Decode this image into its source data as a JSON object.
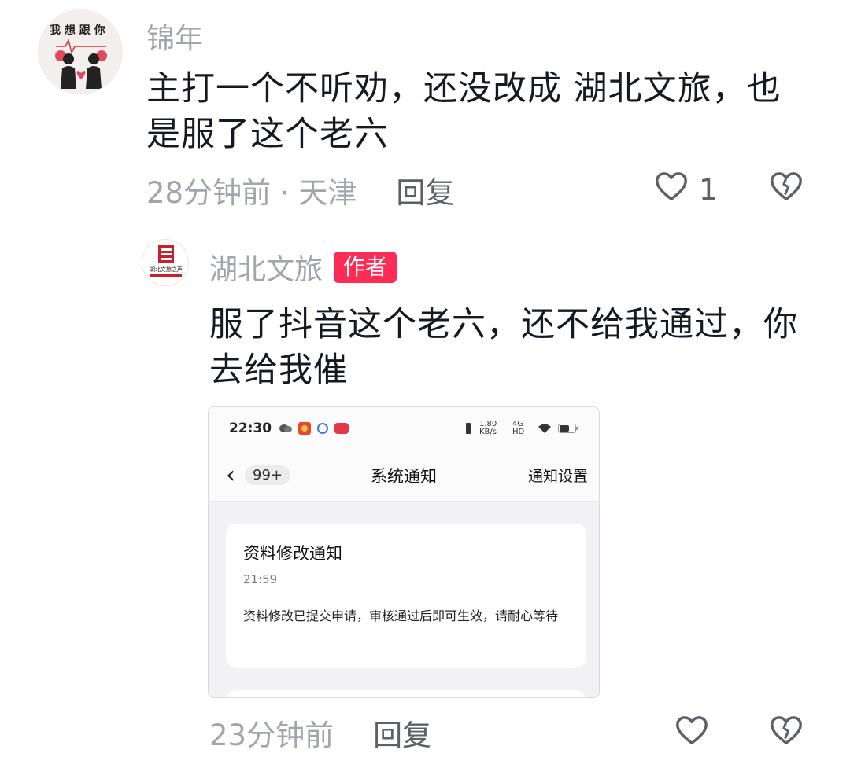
{
  "comment": {
    "username": "锦年",
    "text": "主打一个不听劝，还没改成 湖北文旅，也是服了这个老六",
    "time_location": "28分钟前 · 天津",
    "reply_label": "回复",
    "like_count": "1",
    "avatar_text": "我想跟你在一起",
    "icons": [
      "heart-outline-icon",
      "broken-heart-icon"
    ]
  },
  "reply": {
    "username": "湖北文旅",
    "badge": "作者",
    "text": "服了抖音这个老六，还不给我通过，你去给我催",
    "time": "23分钟前",
    "reply_label": "回复",
    "avatar_text": "湖北文旅之声",
    "icons": [
      "heart-outline-icon",
      "broken-heart-icon"
    ]
  },
  "screenshot": {
    "status_time": "22:30",
    "network_speed": "1.80 KB/s",
    "network_type": "4G HD",
    "nav_count": "99+",
    "nav_title": "系统通知",
    "nav_settings": "通知设置",
    "card_title": "资料修改通知",
    "card_time": "21:59",
    "card_body": "资料修改已提交申请，审核通过后即可生效，请耐心等待"
  },
  "colors": {
    "badge": "#fe2c55",
    "muted_text": "#a3a5ad",
    "primary_text": "#161823"
  }
}
